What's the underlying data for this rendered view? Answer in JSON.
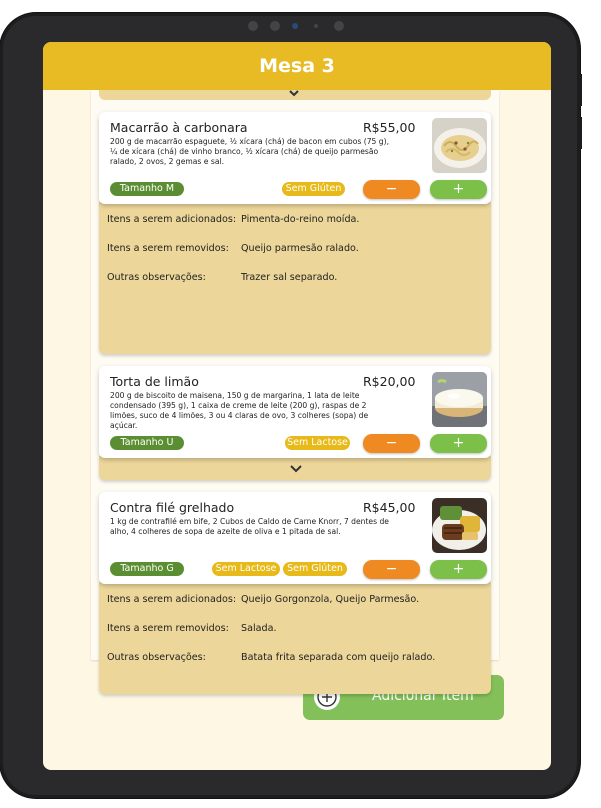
{
  "header": {
    "title": "Mesa 3"
  },
  "items": [
    {
      "name": "Macarrão à carbonara",
      "price": "R$55,00",
      "description": "200 g de macarrão espaguete, ½ xícara (chá) de bacon em cubos (75 g), ¼ de xícara (chá) de vinho branco, ½ xícara (chá) de queijo parmesão ralado, 2 ovos, 2 gemas e sal.",
      "size": "Tamanho M",
      "tags": [
        "Sem Glúten"
      ],
      "minus": "−",
      "plus": "+",
      "details": [
        {
          "label": "Itens a serem adicionados:",
          "value": "Pimenta-do-reino moída."
        },
        {
          "label": "Itens a serem removidos:",
          "value": "Queijo parmesão ralado."
        },
        {
          "label": "Outras observações:",
          "value": "Trazer sal separado."
        }
      ]
    },
    {
      "name": "Torta de limão",
      "price": "R$20,00",
      "description": "200 g de biscoito de maisena, 150 g de margarina, 1 lata de leite condensado (395 g), 1 caixa de creme de leite (200 g), raspas de 2 limões, suco de 4 limões, 3 ou 4 claras de ovo, 3 colheres (sopa) de açúcar.",
      "size": "Tamanho U",
      "tags": [
        "Sem Lactose"
      ],
      "minus": "−",
      "plus": "+"
    },
    {
      "name": "Contra filé grelhado",
      "price": "R$45,00",
      "description": "1 kg de contrafilé em bife, 2 Cubos de Caldo de Carne Knorr, 7 dentes de alho, 4 colheres de sopa de azeite de oliva e 1 pitada de sal.",
      "size": "Tamanho G",
      "tags": [
        "Sem Lactose",
        "Sem Glúten"
      ],
      "minus": "−",
      "plus": "+",
      "details": [
        {
          "label": "Itens a serem adicionados:",
          "value": "Queijo Gorgonzola, Queijo Parmesão."
        },
        {
          "label": "Itens a serem removidos:",
          "value": "Salada."
        },
        {
          "label": "Outras observações:",
          "value": "Batata frita separada com queijo ralado."
        }
      ]
    }
  ],
  "footer": {
    "add_label": "Adicionar Item"
  },
  "colors": {
    "header": "#e8bb24",
    "drawer": "#ecd69a",
    "size_pill": "#5b8e32",
    "tag_pill": "#e7b919",
    "minus_button": "#ef8a23",
    "plus_button": "#7cc04a",
    "add_button": "#83c059"
  }
}
